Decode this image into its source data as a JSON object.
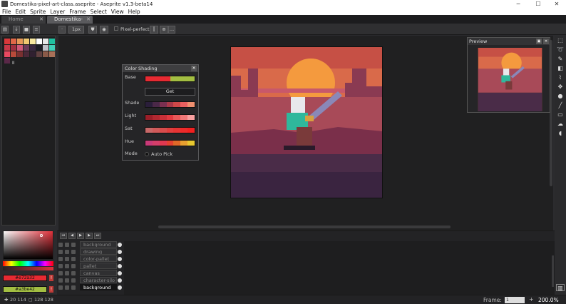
{
  "window": {
    "title": "Domestika-pixel-art-class.aseprite - Aseprite v1.3-beta14",
    "controls": [
      "─",
      "☐",
      "✕"
    ]
  },
  "menu": [
    "File",
    "Edit",
    "Sprite",
    "Layer",
    "Frame",
    "Select",
    "View",
    "Help"
  ],
  "tabs": [
    {
      "label": "Home",
      "active": false
    },
    {
      "label": "Domestika-pixe",
      "active": true
    }
  ],
  "toolbar": {
    "brush_size": "1px",
    "pixel_perfect": "Pixel-perfect"
  },
  "palette": {
    "colors": [
      "#d8383a",
      "#e06848",
      "#e89a58",
      "#f0c870",
      "#f8e8a0",
      "#ffffff",
      "#e8e8e8",
      "#20c0a0",
      "#c83848",
      "#a03040",
      "#d05878",
      "#6a3a58",
      "#3a2840",
      "#1c1c24",
      "#c0c0c8",
      "#40d0b8",
      "#e84860",
      "#b84a3a",
      "#7a3030",
      "#4a2838",
      "#302030",
      "#604040",
      "#8a5a48",
      "#a87058",
      "#5a2848"
    ],
    "count_label": "II"
  },
  "colors": {
    "foreground": "#e72a32",
    "foreground_label": "#e72a32",
    "background": "#a3be42",
    "background_label": "#a3be42",
    "warn_icon": "!"
  },
  "shading": {
    "title": "Color Shading",
    "close_icon": "✕",
    "base_label": "Base",
    "get_button": "Get",
    "rows": [
      {
        "label": "Shade",
        "colors": [
          "#2a1e3a",
          "#4a2848",
          "#7a3050",
          "#a83848",
          "#d04848",
          "#e86060",
          "#f09070"
        ]
      },
      {
        "label": "Light",
        "colors": [
          "#9a1e28",
          "#b02830",
          "#c83038",
          "#e03a40",
          "#e85858",
          "#f07878",
          "#f8a0a0"
        ]
      },
      {
        "label": "Sat",
        "colors": [
          "#c86868",
          "#d05a5a",
          "#d84c4c",
          "#e03e3e",
          "#e63434",
          "#ec2a2a",
          "#f22020"
        ]
      },
      {
        "label": "Hue",
        "colors": [
          "#c83a78",
          "#d43e6a",
          "#e03850",
          "#e44030",
          "#e06828",
          "#e8a030",
          "#e8c830"
        ]
      }
    ],
    "base_colors": [
      "#e72a32",
      "#a3be42"
    ],
    "mode_label": "Mode",
    "auto_pick": "Auto Pick"
  },
  "preview": {
    "title": "Preview"
  },
  "timeline": {
    "frame_header": "1",
    "layers": [
      {
        "name": "background",
        "active": false
      },
      {
        "name": "drawing",
        "active": false
      },
      {
        "name": "color-pallet",
        "active": false
      },
      {
        "name": "pallet",
        "active": false
      },
      {
        "name": "canvas",
        "active": false
      },
      {
        "name": "character-silo",
        "active": false
      },
      {
        "name": "background",
        "active": true
      }
    ]
  },
  "status": {
    "coords": "20 114",
    "size": "128 128",
    "frame_label": "Frame:",
    "frame_value": "1",
    "zoom": "200.0%"
  }
}
